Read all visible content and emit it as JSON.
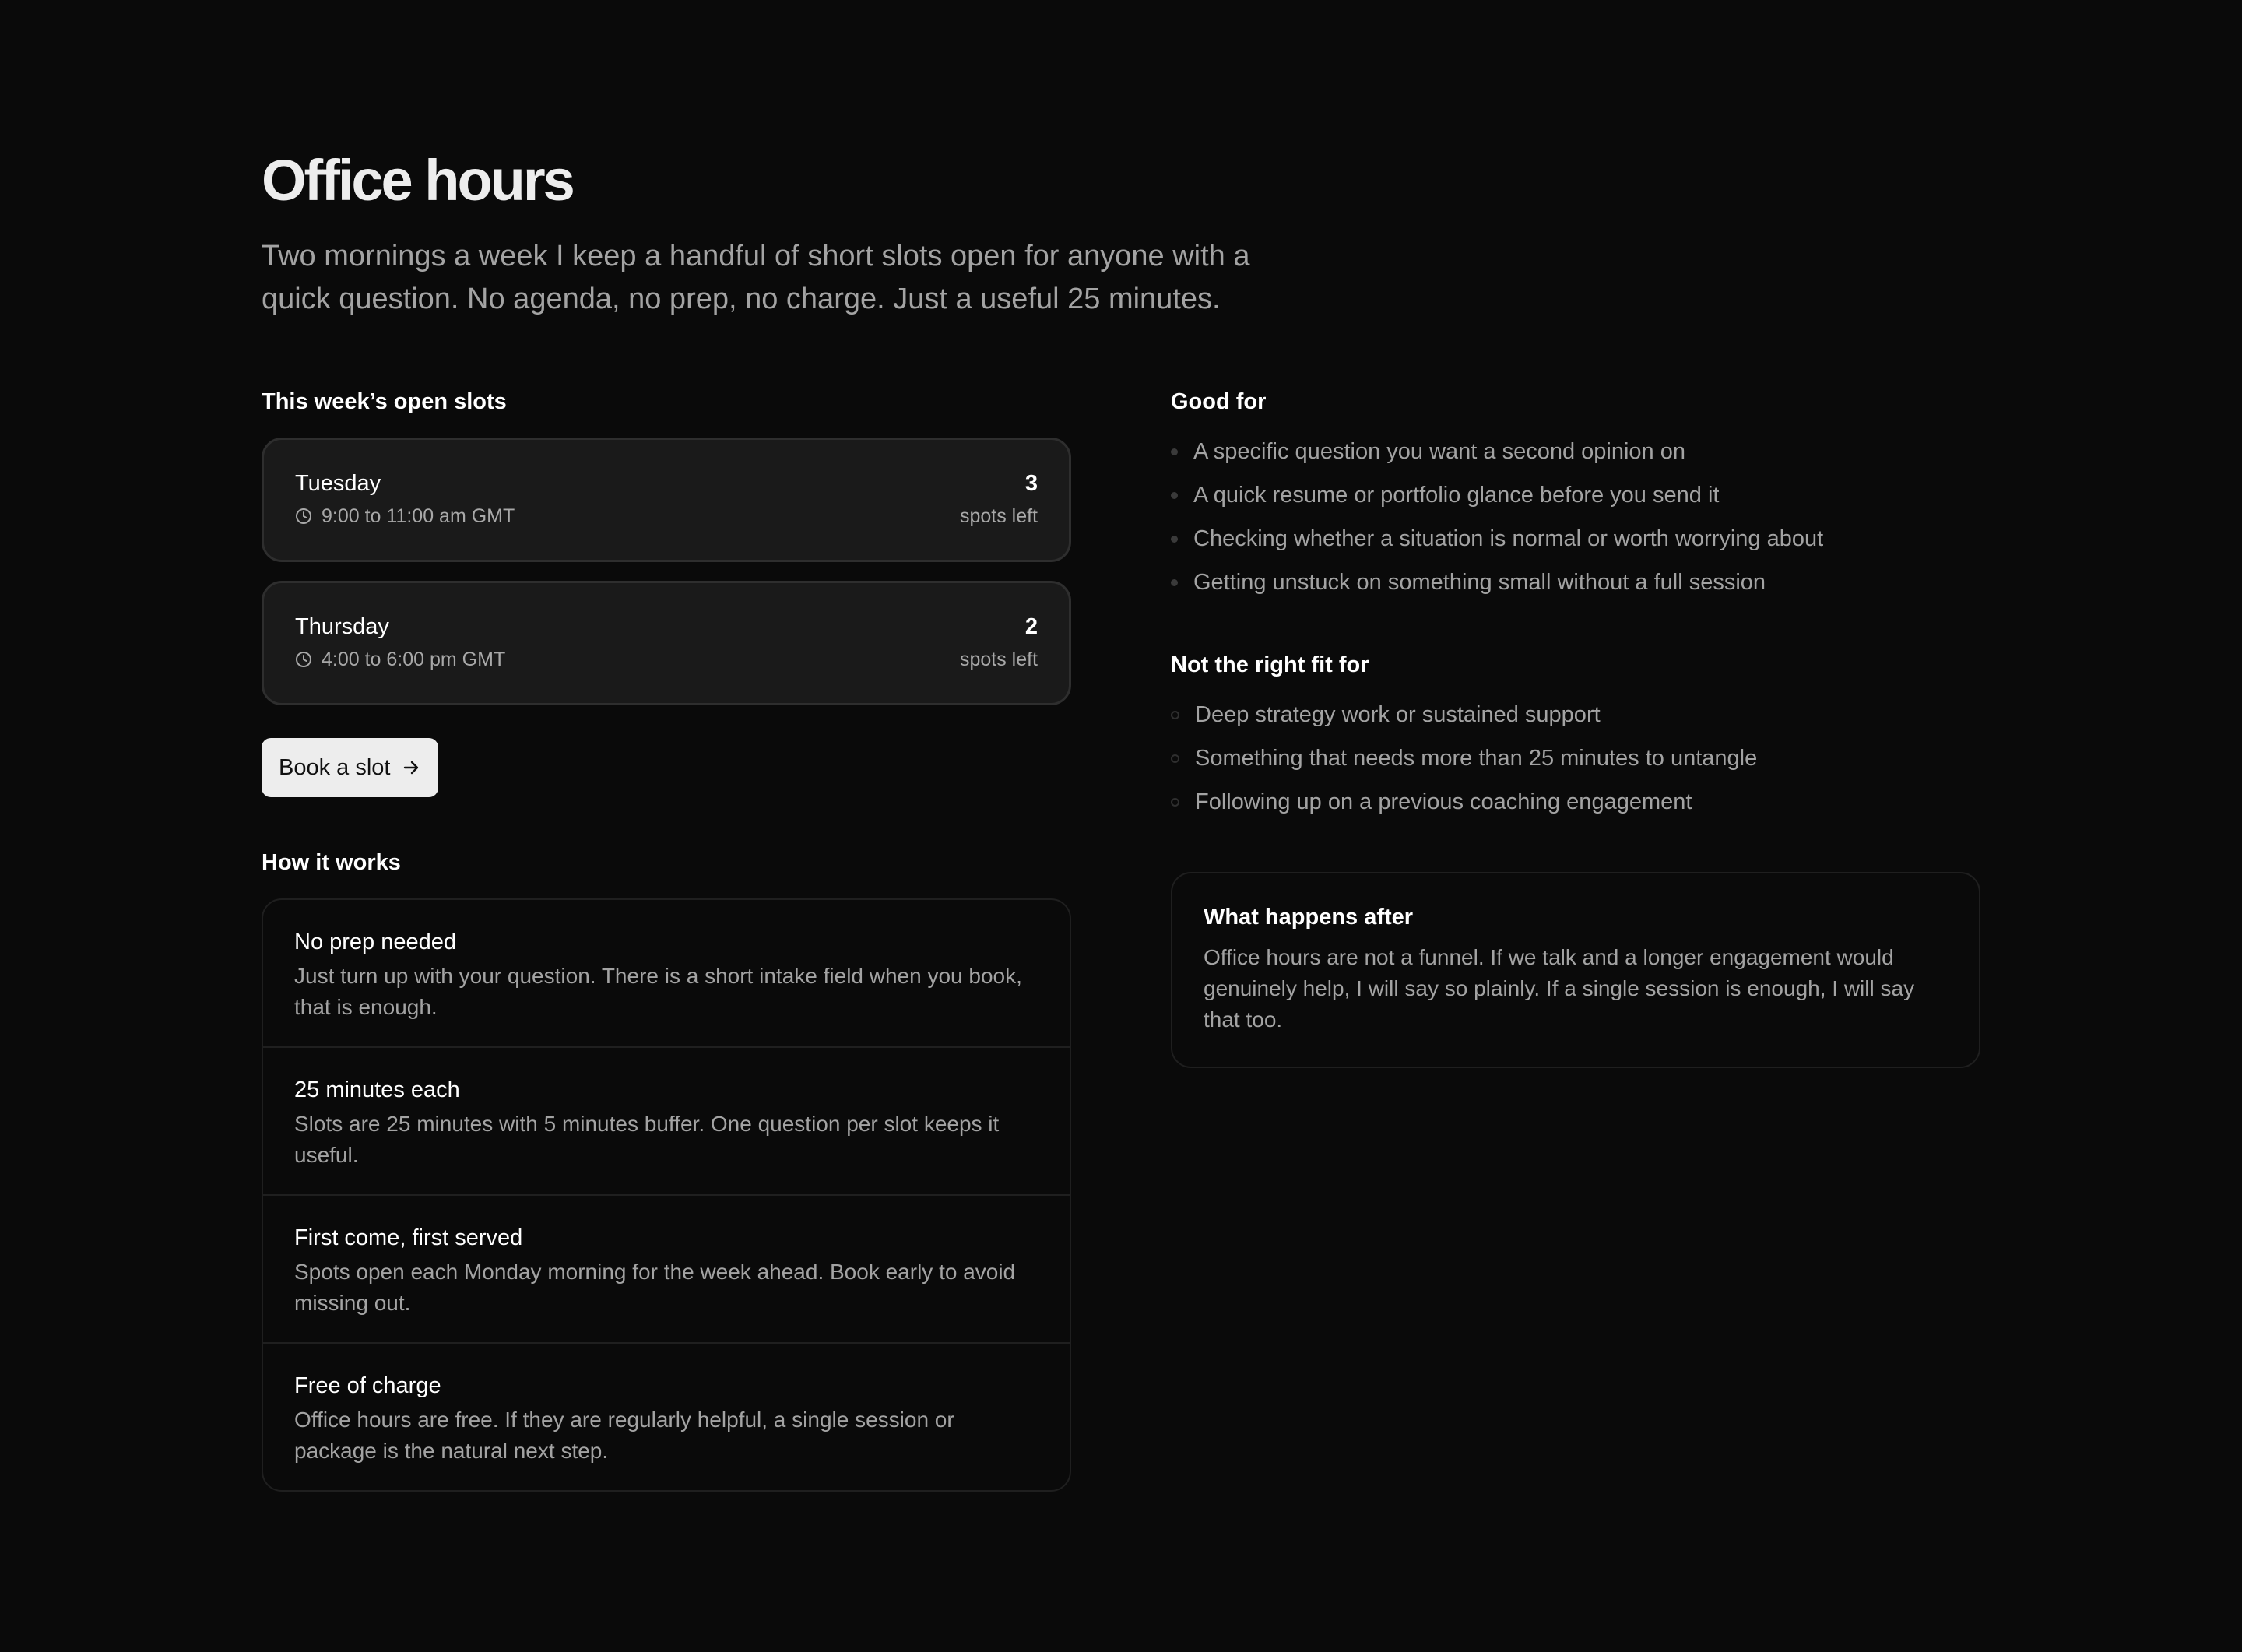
{
  "header": {
    "title": "Office hours",
    "intro": "Two mornings a week I keep a handful of short slots open for anyone with a quick question. No agenda, no prep, no charge. Just a useful 25 minutes."
  },
  "slots": {
    "heading": "This week’s open slots",
    "items": [
      {
        "day": "Tuesday",
        "time": "9:00 to 11:00 am GMT",
        "count": "3",
        "count_label": "spots left"
      },
      {
        "day": "Thursday",
        "time": "4:00 to 6:00 pm GMT",
        "count": "2",
        "count_label": "spots left"
      }
    ],
    "book_label": "Book a slot"
  },
  "how": {
    "heading": "How it works",
    "items": [
      {
        "title": "No prep needed",
        "body": "Just turn up with your question. There is a short intake field when you book, that is enough."
      },
      {
        "title": "25 minutes each",
        "body": "Slots are 25 minutes with 5 minutes buffer. One question per slot keeps it useful."
      },
      {
        "title": "First come, first served",
        "body": "Spots open each Monday morning for the week ahead. Book early to avoid missing out."
      },
      {
        "title": "Free of charge",
        "body": "Office hours are free. If they are regularly helpful, a single session or package is the natural next step."
      }
    ]
  },
  "good_for": {
    "heading": "Good for",
    "items": [
      "A specific question you want a second opinion on",
      "A quick resume or portfolio glance before you send it",
      "Checking whether a situation is normal or worth worrying about",
      "Getting unstuck on something small without a full session"
    ]
  },
  "not_fit": {
    "heading": "Not the right fit for",
    "items": [
      "Deep strategy work or sustained support",
      "Something that needs more than 25 minutes to untangle",
      "Following up on a previous coaching engagement"
    ]
  },
  "after": {
    "heading": "What happens after",
    "body": "Office hours are not a funnel. If we talk and a longer engagement would genuinely help, I will say so plainly. If a single session is enough, I will say that too."
  },
  "icons": {
    "slot_time": "clock-icon",
    "book": "arrow-right-icon",
    "good_for_bullet": "filled-dot-icon",
    "not_fit_bullet": "hollow-dot-icon"
  },
  "colors": {
    "background": "#0a0a0a",
    "card": "#1a1a1a",
    "button": "#ededed",
    "muted_text": "#a3a3a3"
  }
}
